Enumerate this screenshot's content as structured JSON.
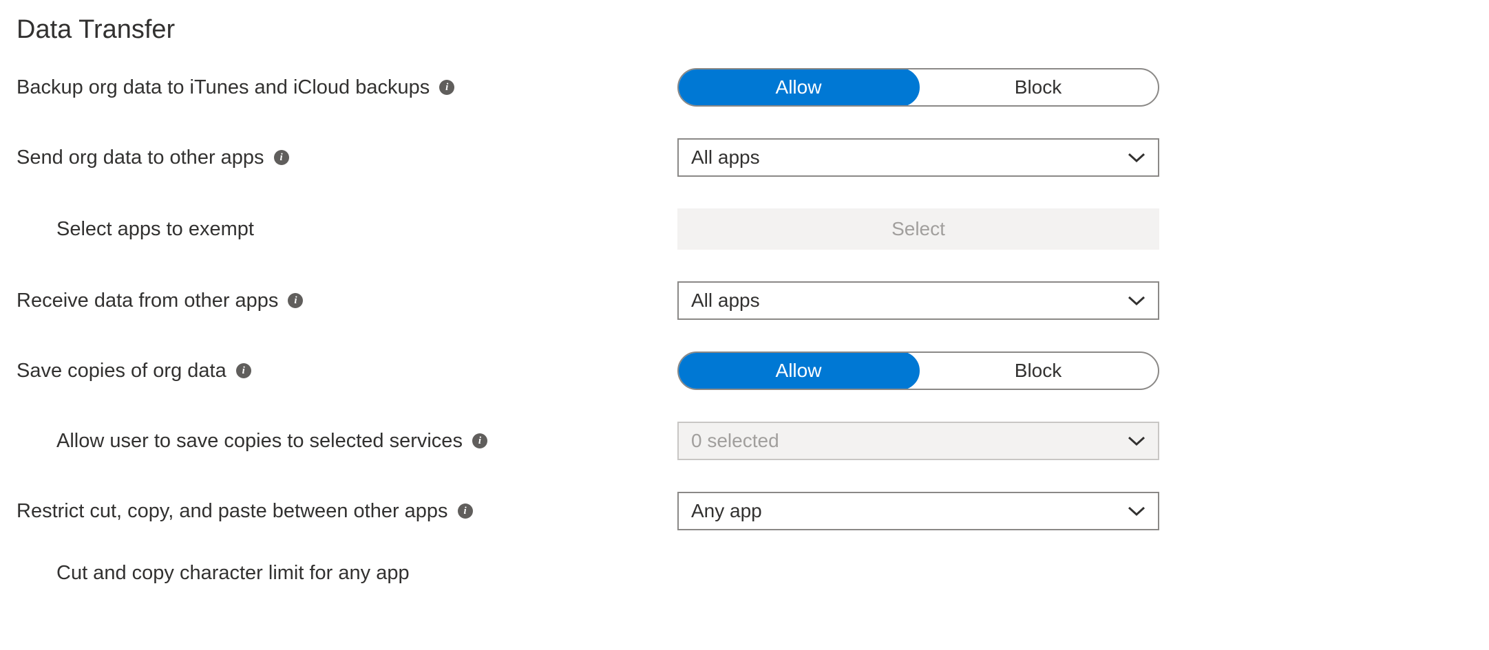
{
  "section": {
    "title": "Data Transfer"
  },
  "rows": {
    "backup": {
      "label": "Backup org data to iTunes and iCloud backups",
      "opt_allow": "Allow",
      "opt_block": "Block"
    },
    "send": {
      "label": "Send org data to other apps",
      "value": "All apps"
    },
    "exempt": {
      "label": "Select apps to exempt",
      "button": "Select"
    },
    "receive": {
      "label": "Receive data from other apps",
      "value": "All apps"
    },
    "savecopies": {
      "label": "Save copies of org data",
      "opt_allow": "Allow",
      "opt_block": "Block"
    },
    "saveservices": {
      "label": "Allow user to save copies to selected services",
      "value": "0 selected"
    },
    "restrict": {
      "label": "Restrict cut, copy, and paste between other apps",
      "value": "Any app"
    },
    "charlimit": {
      "label": "Cut and copy character limit for any app"
    }
  }
}
